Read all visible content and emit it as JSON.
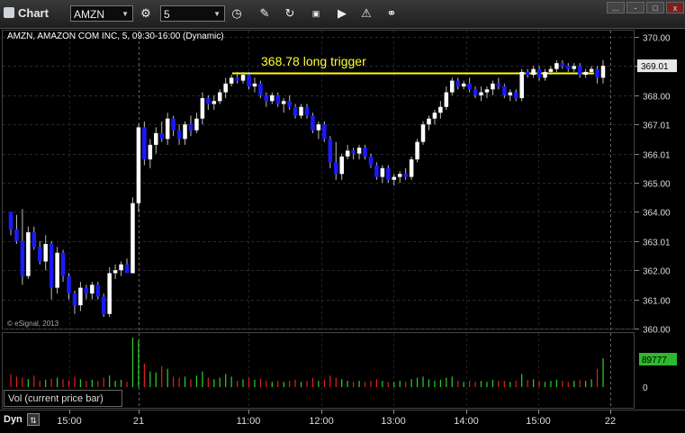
{
  "window": {
    "title": "Chart",
    "close_label": "x",
    "min_label": "-",
    "dots_label": "..."
  },
  "toolbar": {
    "symbol_value": "AMZN",
    "interval_value": "5",
    "icons": [
      "clock-icon",
      "pencil-icon",
      "refresh-icon",
      "gif-icon",
      "play-icon",
      "alert-icon",
      "link-icon"
    ]
  },
  "chart": {
    "study_label": "AMZN, AMAZON COM INC, 5, 09:30-16:00 (Dynamic)",
    "annotation": "368.78 long trigger",
    "copyright": "© eSignal, 2013",
    "current_price": "369.01",
    "y_ticks": [
      "370.00",
      "369.00",
      "368.00",
      "367.01",
      "366.01",
      "365.00",
      "364.00",
      "363.01",
      "362.00",
      "361.00",
      "360.00"
    ],
    "x_ticks": [
      "15:00",
      "21",
      "11:00",
      "12:00",
      "13:00",
      "14:00",
      "15:00",
      "22"
    ],
    "volume_label": "Vol (current price bar)",
    "volume_current": "89777",
    "volume_zero": "0",
    "dyn_label": "Dyn",
    "colors": {
      "up": "#ffffff",
      "down": "#1a1aff",
      "trigger": "#ffff00",
      "vol_up": "#2fd02f",
      "vol_down": "#e02020"
    }
  },
  "chart_data": {
    "type": "candlestick",
    "ylim": [
      360,
      370.2
    ],
    "trigger_level": 368.78,
    "candles": [
      [
        364.0,
        364.0,
        363.2,
        363.4
      ],
      [
        363.4,
        363.9,
        362.9,
        363.0
      ],
      [
        363.0,
        364.1,
        361.5,
        361.8
      ],
      [
        361.8,
        363.5,
        361.7,
        363.3
      ],
      [
        363.3,
        363.5,
        362.7,
        362.8
      ],
      [
        362.8,
        363.0,
        362.2,
        362.3
      ],
      [
        362.3,
        363.2,
        362.0,
        362.9
      ],
      [
        362.9,
        363.0,
        361.0,
        361.4
      ],
      [
        361.4,
        362.8,
        361.2,
        362.6
      ],
      [
        362.6,
        362.7,
        361.6,
        361.8
      ],
      [
        361.8,
        361.9,
        361.0,
        361.2
      ],
      [
        361.2,
        361.3,
        360.5,
        360.8
      ],
      [
        360.8,
        361.6,
        360.6,
        361.4
      ],
      [
        361.4,
        361.5,
        361.0,
        361.2
      ],
      [
        361.2,
        361.6,
        361.0,
        361.5
      ],
      [
        361.5,
        361.6,
        361.0,
        361.1
      ],
      [
        361.1,
        361.2,
        360.4,
        360.5
      ],
      [
        360.5,
        362.1,
        360.4,
        361.9
      ],
      [
        361.9,
        362.2,
        361.7,
        362.0
      ],
      [
        362.0,
        362.3,
        361.8,
        362.2
      ],
      [
        362.2,
        362.4,
        361.9,
        361.9
      ],
      [
        361.9,
        364.5,
        361.9,
        364.3
      ],
      [
        364.3,
        367.0,
        364.0,
        366.9
      ],
      [
        366.9,
        367.1,
        365.6,
        365.8
      ],
      [
        365.8,
        366.5,
        365.5,
        366.3
      ],
      [
        366.3,
        366.9,
        366.0,
        366.7
      ],
      [
        366.7,
        367.1,
        366.4,
        366.5
      ],
      [
        366.5,
        367.4,
        366.3,
        367.2
      ],
      [
        367.2,
        367.3,
        366.6,
        366.8
      ],
      [
        366.8,
        367.0,
        366.3,
        366.5
      ],
      [
        366.5,
        367.1,
        366.3,
        367.0
      ],
      [
        367.0,
        367.3,
        366.6,
        366.8
      ],
      [
        366.8,
        367.4,
        366.7,
        367.2
      ],
      [
        367.2,
        368.1,
        367.0,
        367.9
      ],
      [
        367.9,
        368.0,
        367.5,
        367.7
      ],
      [
        367.7,
        368.0,
        367.5,
        367.8
      ],
      [
        367.8,
        368.2,
        367.7,
        368.1
      ],
      [
        368.1,
        368.6,
        367.9,
        368.4
      ],
      [
        368.4,
        368.7,
        368.3,
        368.6
      ],
      [
        368.6,
        368.8,
        368.4,
        368.5
      ],
      [
        368.5,
        368.8,
        368.4,
        368.7
      ],
      [
        368.7,
        368.8,
        368.2,
        368.3
      ],
      [
        368.3,
        368.6,
        368.1,
        368.4
      ],
      [
        368.4,
        368.5,
        367.9,
        368.0
      ],
      [
        368.0,
        368.1,
        367.6,
        367.8
      ],
      [
        367.8,
        368.1,
        367.7,
        368.0
      ],
      [
        368.0,
        368.1,
        367.6,
        367.7
      ],
      [
        367.7,
        367.9,
        367.4,
        367.8
      ],
      [
        367.8,
        368.0,
        367.5,
        367.6
      ],
      [
        367.6,
        367.7,
        367.2,
        367.3
      ],
      [
        367.3,
        367.7,
        367.2,
        367.6
      ],
      [
        367.6,
        367.7,
        367.2,
        367.3
      ],
      [
        367.3,
        367.4,
        366.7,
        366.8
      ],
      [
        366.8,
        367.1,
        366.5,
        367.0
      ],
      [
        367.0,
        367.1,
        366.4,
        366.5
      ],
      [
        366.5,
        366.6,
        365.5,
        365.7
      ],
      [
        365.7,
        366.4,
        365.1,
        365.3
      ],
      [
        365.3,
        366.0,
        365.1,
        365.9
      ],
      [
        365.9,
        366.3,
        365.8,
        366.1
      ],
      [
        366.1,
        366.2,
        365.8,
        366.0
      ],
      [
        366.0,
        366.3,
        365.8,
        366.2
      ],
      [
        366.2,
        366.3,
        365.8,
        365.9
      ],
      [
        365.9,
        366.0,
        365.5,
        365.6
      ],
      [
        365.6,
        365.7,
        365.1,
        365.2
      ],
      [
        365.2,
        365.6,
        365.0,
        365.5
      ],
      [
        365.5,
        365.6,
        365.0,
        365.1
      ],
      [
        365.1,
        365.3,
        364.9,
        365.2
      ],
      [
        365.2,
        365.4,
        365.0,
        365.3
      ],
      [
        365.3,
        365.5,
        365.1,
        365.2
      ],
      [
        365.2,
        365.9,
        365.1,
        365.8
      ],
      [
        365.8,
        366.5,
        365.7,
        366.4
      ],
      [
        366.4,
        367.1,
        366.3,
        367.0
      ],
      [
        367.0,
        367.3,
        366.8,
        367.2
      ],
      [
        367.2,
        367.5,
        367.0,
        367.4
      ],
      [
        367.4,
        367.8,
        367.2,
        367.6
      ],
      [
        367.6,
        368.3,
        367.5,
        368.1
      ],
      [
        368.1,
        368.6,
        368.0,
        368.5
      ],
      [
        368.5,
        368.6,
        368.2,
        368.3
      ],
      [
        368.3,
        368.5,
        368.2,
        368.4
      ],
      [
        368.4,
        368.6,
        368.1,
        368.2
      ],
      [
        368.2,
        368.3,
        367.9,
        368.0
      ],
      [
        368.0,
        368.3,
        367.8,
        368.1
      ],
      [
        368.1,
        368.3,
        367.9,
        368.2
      ],
      [
        368.2,
        368.5,
        368.0,
        368.4
      ],
      [
        368.4,
        368.6,
        368.2,
        368.3
      ],
      [
        368.3,
        368.4,
        367.9,
        368.0
      ],
      [
        368.0,
        368.2,
        367.8,
        368.1
      ],
      [
        368.1,
        368.2,
        367.8,
        367.9
      ],
      [
        367.9,
        368.9,
        367.8,
        368.8
      ],
      [
        368.8,
        368.9,
        368.6,
        368.7
      ],
      [
        368.7,
        369.0,
        368.6,
        368.9
      ],
      [
        368.9,
        369.0,
        368.5,
        368.6
      ],
      [
        368.6,
        368.9,
        368.5,
        368.8
      ],
      [
        368.8,
        369.0,
        368.7,
        368.9
      ],
      [
        368.9,
        369.2,
        368.8,
        369.1
      ],
      [
        369.1,
        369.2,
        368.9,
        369.0
      ],
      [
        369.0,
        369.1,
        368.8,
        368.9
      ],
      [
        368.9,
        369.1,
        368.8,
        369.0
      ],
      [
        369.0,
        369.1,
        368.6,
        368.7
      ],
      [
        368.7,
        368.9,
        368.6,
        368.8
      ],
      [
        368.8,
        369.0,
        368.7,
        368.9
      ],
      [
        368.9,
        369.0,
        368.4,
        368.6
      ],
      [
        368.6,
        369.2,
        368.4,
        369.01
      ]
    ],
    "volume": [
      {
        "v": 0.25,
        "up": false
      },
      {
        "v": 0.2,
        "up": false
      },
      {
        "v": 0.18,
        "up": false
      },
      {
        "v": 0.15,
        "up": true
      },
      {
        "v": 0.22,
        "up": false
      },
      {
        "v": 0.12,
        "up": false
      },
      {
        "v": 0.14,
        "up": true
      },
      {
        "v": 0.16,
        "up": false
      },
      {
        "v": 0.18,
        "up": true
      },
      {
        "v": 0.15,
        "up": false
      },
      {
        "v": 0.13,
        "up": false
      },
      {
        "v": 0.2,
        "up": false
      },
      {
        "v": 0.15,
        "up": true
      },
      {
        "v": 0.12,
        "up": false
      },
      {
        "v": 0.14,
        "up": true
      },
      {
        "v": 0.12,
        "up": false
      },
      {
        "v": 0.18,
        "up": false
      },
      {
        "v": 0.22,
        "up": true
      },
      {
        "v": 0.12,
        "up": true
      },
      {
        "v": 0.14,
        "up": true
      },
      {
        "v": 0.1,
        "up": false
      },
      {
        "v": 0.95,
        "up": true
      },
      {
        "v": 0.9,
        "up": true
      },
      {
        "v": 0.45,
        "up": false
      },
      {
        "v": 0.3,
        "up": true
      },
      {
        "v": 0.28,
        "up": true
      },
      {
        "v": 0.4,
        "up": false
      },
      {
        "v": 0.35,
        "up": true
      },
      {
        "v": 0.2,
        "up": false
      },
      {
        "v": 0.18,
        "up": false
      },
      {
        "v": 0.2,
        "up": true
      },
      {
        "v": 0.15,
        "up": false
      },
      {
        "v": 0.22,
        "up": true
      },
      {
        "v": 0.3,
        "up": true
      },
      {
        "v": 0.18,
        "up": false
      },
      {
        "v": 0.15,
        "up": true
      },
      {
        "v": 0.18,
        "up": true
      },
      {
        "v": 0.25,
        "up": true
      },
      {
        "v": 0.2,
        "up": true
      },
      {
        "v": 0.12,
        "up": false
      },
      {
        "v": 0.15,
        "up": true
      },
      {
        "v": 0.18,
        "up": false
      },
      {
        "v": 0.14,
        "up": true
      },
      {
        "v": 0.16,
        "up": false
      },
      {
        "v": 0.12,
        "up": false
      },
      {
        "v": 0.1,
        "up": true
      },
      {
        "v": 0.12,
        "up": false
      },
      {
        "v": 0.1,
        "up": true
      },
      {
        "v": 0.12,
        "up": false
      },
      {
        "v": 0.14,
        "up": false
      },
      {
        "v": 0.1,
        "up": true
      },
      {
        "v": 0.12,
        "up": false
      },
      {
        "v": 0.18,
        "up": false
      },
      {
        "v": 0.12,
        "up": true
      },
      {
        "v": 0.14,
        "up": false
      },
      {
        "v": 0.22,
        "up": false
      },
      {
        "v": 0.18,
        "up": false
      },
      {
        "v": 0.15,
        "up": true
      },
      {
        "v": 0.12,
        "up": true
      },
      {
        "v": 0.1,
        "up": false
      },
      {
        "v": 0.12,
        "up": true
      },
      {
        "v": 0.1,
        "up": false
      },
      {
        "v": 0.12,
        "up": false
      },
      {
        "v": 0.15,
        "up": false
      },
      {
        "v": 0.12,
        "up": true
      },
      {
        "v": 0.1,
        "up": false
      },
      {
        "v": 0.1,
        "up": true
      },
      {
        "v": 0.12,
        "up": true
      },
      {
        "v": 0.1,
        "up": false
      },
      {
        "v": 0.15,
        "up": true
      },
      {
        "v": 0.18,
        "up": true
      },
      {
        "v": 0.2,
        "up": true
      },
      {
        "v": 0.15,
        "up": true
      },
      {
        "v": 0.12,
        "up": true
      },
      {
        "v": 0.14,
        "up": true
      },
      {
        "v": 0.18,
        "up": true
      },
      {
        "v": 0.2,
        "up": true
      },
      {
        "v": 0.12,
        "up": false
      },
      {
        "v": 0.1,
        "up": true
      },
      {
        "v": 0.12,
        "up": false
      },
      {
        "v": 0.1,
        "up": false
      },
      {
        "v": 0.12,
        "up": true
      },
      {
        "v": 0.1,
        "up": true
      },
      {
        "v": 0.14,
        "up": true
      },
      {
        "v": 0.12,
        "up": false
      },
      {
        "v": 0.12,
        "up": false
      },
      {
        "v": 0.1,
        "up": true
      },
      {
        "v": 0.12,
        "up": false
      },
      {
        "v": 0.25,
        "up": true
      },
      {
        "v": 0.14,
        "up": false
      },
      {
        "v": 0.15,
        "up": true
      },
      {
        "v": 0.12,
        "up": false
      },
      {
        "v": 0.1,
        "up": true
      },
      {
        "v": 0.12,
        "up": true
      },
      {
        "v": 0.14,
        "up": true
      },
      {
        "v": 0.12,
        "up": false
      },
      {
        "v": 0.1,
        "up": false
      },
      {
        "v": 0.12,
        "up": true
      },
      {
        "v": 0.14,
        "up": false
      },
      {
        "v": 0.12,
        "up": true
      },
      {
        "v": 0.15,
        "up": true
      },
      {
        "v": 0.35,
        "up": false
      },
      {
        "v": 0.55,
        "up": true
      }
    ]
  }
}
